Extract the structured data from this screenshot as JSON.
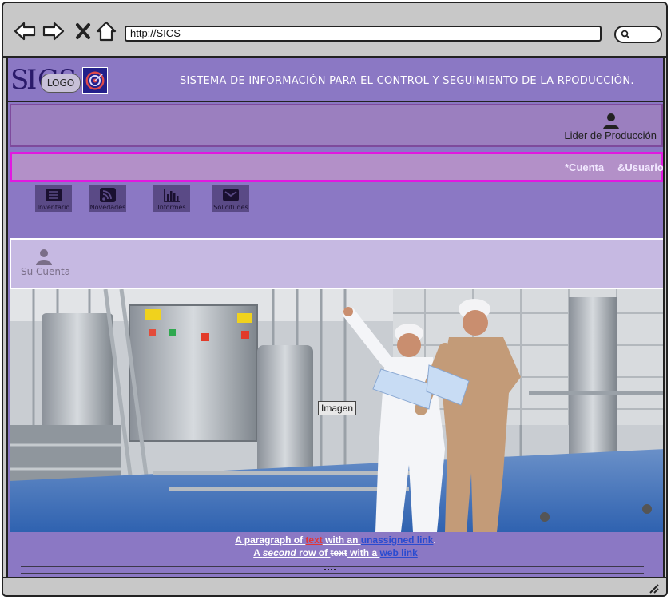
{
  "browser": {
    "url": "http://SICS",
    "icons": [
      "back-icon",
      "forward-icon",
      "close-icon",
      "home-icon",
      "search-icon"
    ]
  },
  "header": {
    "logo_letters": [
      "S",
      "I",
      "C",
      "S"
    ],
    "logo_label": "LOGO",
    "title": "SISTEMA DE INFORMACIÓN PARA EL CONTROL Y SEGUIMIENTO DE LA RPODUCCIÓN."
  },
  "role": {
    "label": "Lider de Producción",
    "icon": "user-icon"
  },
  "nav": {
    "cuenta": "*Cuenta",
    "usuario": "&Usuario"
  },
  "tiles": [
    {
      "label": "Inventario",
      "icon": "list-icon"
    },
    {
      "label": "Novedades",
      "icon": "rss-icon"
    },
    {
      "label": "Informes",
      "icon": "bar-chart-icon"
    },
    {
      "label": "Solicitudes",
      "icon": "envelope-icon"
    }
  ],
  "account": {
    "label": "Su Cuenta",
    "icon": "user-icon"
  },
  "hero": {
    "tag": "Imagen"
  },
  "paragraph": {
    "line1_a": "A paragraph of ",
    "line1_link1": "text",
    "line1_b": " with an ",
    "line1_link2": "unassigned link",
    "line1_c": ".",
    "line2_a": "A ",
    "line2_em": "second",
    "line2_b": " row of ",
    "line2_strike": "text",
    "line2_c": " with a ",
    "line2_link": "web link"
  },
  "colors": {
    "page_bg": "#8b78c4",
    "role_bar": "#9b7fbf",
    "nav_border": "#e01ae0",
    "account_panel": "#c6b9e2",
    "tile_bg": "#5a4a86"
  }
}
